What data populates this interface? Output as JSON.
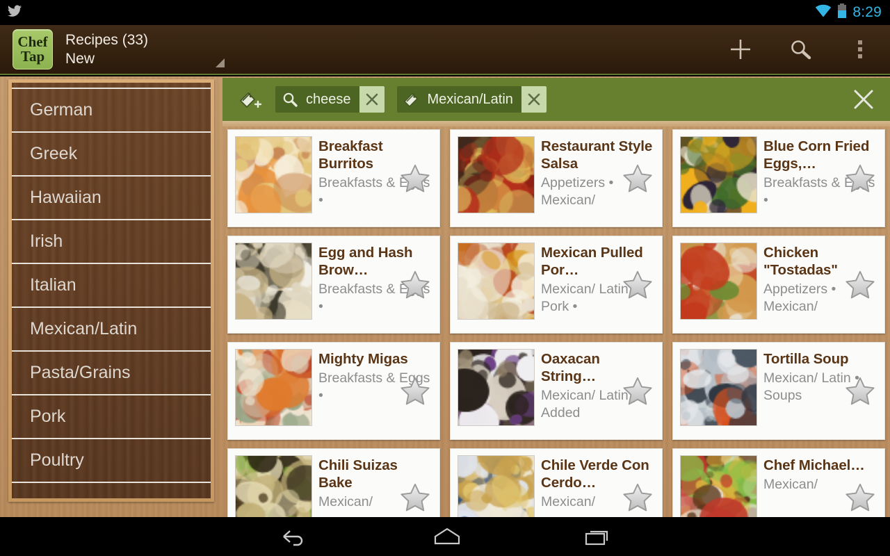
{
  "statusbar": {
    "notification_icon": "twitter-icon",
    "wifi_icon": "wifi-icon",
    "battery_icon": "battery-icon",
    "clock": "8:29",
    "clock_color": "#33b5e5"
  },
  "actionbar": {
    "logo_line1": "Chef",
    "logo_line2": "Tap",
    "title": "Recipes (33)",
    "subtitle": "New",
    "spinner_icon": "dropdown-triangle-icon",
    "actions": [
      {
        "name": "add-recipe-button",
        "icon": "plus-icon"
      },
      {
        "name": "search-button",
        "icon": "search-icon"
      },
      {
        "name": "overflow-menu-button",
        "icon": "kebab-menu-icon"
      }
    ]
  },
  "sidebar": {
    "items": [
      {
        "label": "German"
      },
      {
        "label": "Greek"
      },
      {
        "label": "Hawaiian"
      },
      {
        "label": "Irish"
      },
      {
        "label": "Italian"
      },
      {
        "label": "Mexican/Latin"
      },
      {
        "label": "Pasta/Grains"
      },
      {
        "label": "Pork"
      },
      {
        "label": "Poultry"
      }
    ]
  },
  "filterbar": {
    "background_color": "#67802f",
    "add_tag_icon": "tag-add-icon",
    "chips": [
      {
        "icon": "search-icon",
        "label": "cheese",
        "remove_icon": "close-icon"
      },
      {
        "icon": "tag-icon",
        "label": "Mexican/Latin",
        "remove_icon": "close-icon"
      }
    ],
    "close_icon": "close-icon"
  },
  "recipes": [
    {
      "title": "Breakfast Burritos",
      "subtitle": "Breakfasts & Eggs •",
      "star_icon": "star-outline-icon",
      "thumb": "breakfast-burritos-photo",
      "palette": [
        "#e8903a",
        "#f3e3bd",
        "#e3c67a",
        "#c98a55",
        "#f6efe0"
      ]
    },
    {
      "title": "Restaurant Style Salsa",
      "subtitle": "Appetizers • Mexican/",
      "star_icon": "star-outline-icon",
      "thumb": "restaurant-style-salsa-photo",
      "palette": [
        "#b5301b",
        "#e6c258",
        "#8e1f13",
        "#d8b05a",
        "#3a2a1e"
      ]
    },
    {
      "title": "Blue Corn Fried Eggs,…",
      "subtitle": "Breakfasts & Eggs •",
      "star_icon": "star-outline-icon",
      "thumb": "blue-corn-fried-eggs-photo",
      "palette": [
        "#6a4a22",
        "#e7e0cb",
        "#f0b01e",
        "#3f6b2a",
        "#2b2438"
      ]
    },
    {
      "title": "Egg and Hash Brow…",
      "subtitle": "Breakfasts & Eggs •",
      "star_icon": "star-outline-icon",
      "thumb": "egg-hash-brown-photo",
      "palette": [
        "#f2efe8",
        "#e8dfc6",
        "#c9b487",
        "#3d3a2c",
        "#dfd6c0"
      ]
    },
    {
      "title": "Mexican Pulled Por…",
      "subtitle": "Mexican/ Latin • Pork •",
      "star_icon": "star-outline-icon",
      "thumb": "mexican-pulled-pork-photo",
      "palette": [
        "#d99a1e",
        "#f4efe1",
        "#b8431c",
        "#e8e0cd",
        "#cdb78c"
      ]
    },
    {
      "title": "Chicken \"Tostadas\"",
      "subtitle": "Appetizers • Mexican/",
      "star_icon": "star-outline-icon",
      "thumb": "chicken-tostadas-photo",
      "palette": [
        "#e3c38d",
        "#c23a1c",
        "#6f8c33",
        "#e8e2d4",
        "#d39a4e"
      ]
    },
    {
      "title": "Mighty Migas",
      "subtitle": "Breakfasts & Eggs •",
      "star_icon": "star-outline-icon",
      "thumb": "mighty-migas-photo",
      "palette": [
        "#e07a2c",
        "#f0e6d3",
        "#c1482a",
        "#9aa88a",
        "#d9cbb2"
      ]
    },
    {
      "title": "Oaxacan String…",
      "subtitle": "Mexican/ Latin | Added",
      "star_icon": "star-outline-icon",
      "thumb": "oaxacan-string-cheese-photo",
      "palette": [
        "#6b3f85",
        "#efeef0",
        "#2a221c",
        "#d8cfc2",
        "#8f7f66"
      ]
    },
    {
      "title": "Tortilla Soup",
      "subtitle": "Mexican/ Latin • Soups",
      "star_icon": "star-outline-icon",
      "thumb": "tortilla-soup-photo",
      "palette": [
        "#4a5663",
        "#d9511f",
        "#e4e7ea",
        "#2c3540",
        "#b9c2c9"
      ]
    },
    {
      "title": "Chili Suizas Bake",
      "subtitle": "Mexican/",
      "star_icon": "star-outline-icon",
      "thumb": "chili-suizas-bake-photo",
      "palette": [
        "#2c2414",
        "#7cb032",
        "#e6dcb6",
        "#c4b27a",
        "#4a3a1c"
      ]
    },
    {
      "title": "Chile Verde Con Cerdo…",
      "subtitle": "Mexican/",
      "star_icon": "star-outline-icon",
      "thumb": "chile-verde-con-cerdo-photo",
      "palette": [
        "#dfe4ee",
        "#e5c96f",
        "#c9a24e",
        "#2f4f84",
        "#efe8d6"
      ]
    },
    {
      "title": "Chef Michael…",
      "subtitle": "Mexican/",
      "star_icon": "star-outline-icon",
      "thumb": "chef-michael-photo",
      "palette": [
        "#c0392b",
        "#efe9dd",
        "#e0b33c",
        "#5c3a1e",
        "#84c24a"
      ]
    }
  ],
  "navbar": {
    "buttons": [
      {
        "name": "nav-back-button",
        "icon": "back-arrow-icon"
      },
      {
        "name": "nav-home-button",
        "icon": "home-icon"
      },
      {
        "name": "nav-recents-button",
        "icon": "recents-icon"
      }
    ]
  }
}
